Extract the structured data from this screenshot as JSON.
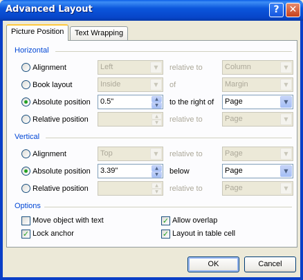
{
  "window": {
    "title": "Advanced Layout",
    "help_label": "?",
    "close_label": "✕"
  },
  "tabs": [
    {
      "label": "Picture Position"
    },
    {
      "label": "Text Wrapping"
    }
  ],
  "horizontal": {
    "section_label": "Horizontal",
    "rows": [
      {
        "label": "Alignment",
        "selected": false,
        "value": "Left",
        "relation": "relative to",
        "target": "Column"
      },
      {
        "label": "Book layout",
        "selected": false,
        "value": "Inside",
        "relation": "of",
        "target": "Margin"
      },
      {
        "label": "Absolute position",
        "selected": true,
        "value": "0.5\"",
        "relation": "to the right of",
        "target": "Page"
      },
      {
        "label": "Relative position",
        "selected": false,
        "value": "",
        "relation": "relative to",
        "target": "Page"
      }
    ]
  },
  "vertical": {
    "section_label": "Vertical",
    "rows": [
      {
        "label": "Alignment",
        "selected": false,
        "value": "Top",
        "relation": "relative to",
        "target": "Page"
      },
      {
        "label": "Absolute position",
        "selected": true,
        "value": "3.39\"",
        "relation": "below",
        "target": "Page"
      },
      {
        "label": "Relative position",
        "selected": false,
        "value": "",
        "relation": "relative to",
        "target": "Page"
      }
    ]
  },
  "options": {
    "section_label": "Options",
    "items": [
      {
        "label": "Move object with text",
        "checked": false
      },
      {
        "label": "Allow overlap",
        "checked": true
      },
      {
        "label": "Lock anchor",
        "checked": true
      },
      {
        "label": "Layout in table cell",
        "checked": true
      }
    ]
  },
  "buttons": {
    "ok": "OK",
    "cancel": "Cancel"
  },
  "colors": {
    "title_bar": "#0a56dc",
    "section_title": "#0046d5",
    "dialog_face": "#ece9d8"
  }
}
